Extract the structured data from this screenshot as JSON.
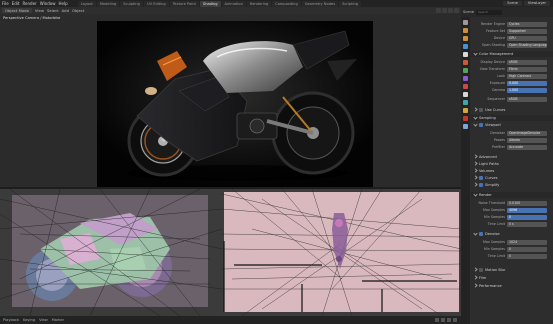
{
  "topbar": {
    "menu": [
      "File",
      "Edit",
      "Render",
      "Window",
      "Help"
    ],
    "workspaces": [
      "Layout",
      "Modeling",
      "Sculpting",
      "UV Editing",
      "Texture Paint",
      "Shading",
      "Animation",
      "Rendering",
      "Compositing",
      "Geometry Nodes",
      "Scripting"
    ],
    "active_workspace": "Shading",
    "scene": "Scene",
    "view_layer": "ViewLayer"
  },
  "viewport": {
    "header_items": [
      "Object Mode",
      "View",
      "Select",
      "Add",
      "Object"
    ],
    "label": "Perspective Camera / Motorbike"
  },
  "bottombar": {
    "items": [
      "Playback",
      "Keying",
      "View",
      "Marker"
    ]
  },
  "outliner": {
    "title": "Scene",
    "search_placeholder": "Search"
  },
  "properties": {
    "tab_colors": [
      "#9a9a9a",
      "#c9913b",
      "#c9913b",
      "#4a8fd1",
      "#d8d8d8",
      "#c75a3a",
      "#5aa05a",
      "#8a5ad1",
      "#c84a4a",
      "#d6d6d6",
      "#3ea8a8",
      "#d2a640",
      "#c0392b",
      "#7aa7d8"
    ],
    "rows": [
      {
        "label": "Render Engine",
        "value": "Cycles"
      },
      {
        "label": "Feature Set",
        "value": "Supported"
      },
      {
        "label": "Device",
        "value": "GPU"
      },
      {
        "label": "Open Shading",
        "value": "Open Shading Language"
      },
      {
        "label": "Color Management",
        "value": ""
      },
      {
        "label": "Display Device",
        "value": "sRGB"
      },
      {
        "label": "View Transform",
        "value": "Filmic"
      },
      {
        "label": "Look",
        "value": "High Contrast"
      },
      {
        "label": "Exposure",
        "value": "0.000"
      },
      {
        "label": "Gamma",
        "value": "1.000"
      },
      {
        "label": "Sequencer",
        "value": "sRGB"
      }
    ],
    "sections": [
      "Use Curves",
      "Sampling",
      "Viewport",
      "Noise Threshold",
      "Max Samples",
      "Render",
      "Denoise",
      "Advanced",
      "Light Paths",
      "Volumes",
      "Curves",
      "Simplify",
      "Motion Blur",
      "Film",
      "Performance"
    ],
    "sampling_rows": [
      {
        "label": "Denoiser",
        "value": "OpenImageDenoise"
      },
      {
        "label": "Passes",
        "value": "Albedo"
      },
      {
        "label": "Prefilter",
        "value": "Accurate"
      }
    ],
    "render_rows": [
      {
        "label": "Noise Threshold",
        "value": "0.0100"
      },
      {
        "label": "Max Samples",
        "value": "4096"
      },
      {
        "label": "Min Samples",
        "value": "0"
      },
      {
        "label": "Time Limit",
        "value": "0 s"
      }
    ],
    "render2_rows": [
      {
        "label": "Max Samples",
        "value": "1024"
      },
      {
        "label": "Min Samples",
        "value": "0"
      },
      {
        "label": "Time Limit",
        "value": "0"
      }
    ]
  }
}
